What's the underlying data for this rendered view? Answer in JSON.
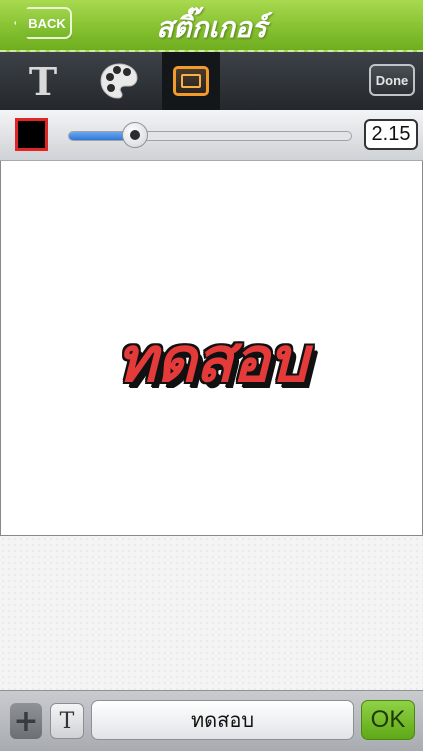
{
  "header": {
    "back_label": "BACK",
    "title": "สติ๊กเกอร์"
  },
  "toolbar": {
    "text_tool_glyph": "T",
    "text_tool_icon": "text-tool-icon",
    "palette_icon": "palette-icon",
    "frame_icon": "frame-icon",
    "selected_tool": "frame",
    "done_label": "Done"
  },
  "stroke": {
    "color": "#000000",
    "value": "2.15",
    "slider_fraction": 0.235
  },
  "canvas": {
    "sticker_text": "ทดสอบ",
    "fill_color": "#e53a3a",
    "stroke_color": "#111111"
  },
  "bottom": {
    "plus_glyph": "+",
    "t_glyph": "T",
    "text_value": "ทดสอบ",
    "ok_label": "OK"
  },
  "colors": {
    "header_green": "#86c232",
    "accent_orange": "#f29a2a",
    "ok_green": "#5fa818"
  }
}
